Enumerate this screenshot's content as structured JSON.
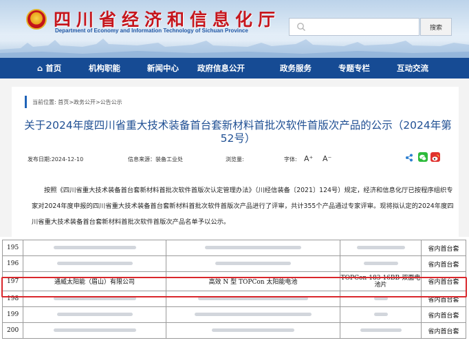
{
  "header": {
    "title": "四川省经济和信息化厅",
    "subtitle": "Department of Economy and Information Technology of Sichuan Province",
    "search_button": "搜索",
    "search_placeholder": ""
  },
  "nav": {
    "items": [
      "首页",
      "机构职能",
      "新闻中心",
      "政府信息公开",
      "政务服务",
      "专题专栏",
      "互动交流"
    ]
  },
  "breadcrumb": "当前位置: 首页>政务公开>公告公示",
  "article": {
    "title": "关于2024年度四川省重大技术装备首台套新材料首批次软件首版次产品的公示（2024年第52号）",
    "date": "发布日期:2024-12-10",
    "source": "信息来源：装备工业处",
    "views": "浏览量:",
    "font_label": "字体:",
    "font_larger": "A⁺",
    "font_smaller": "A⁻",
    "body": "按照《四川省重大技术装备首台套新材料首批次软件首版次认定管理办法》（川经信装备〔2021〕124号）规定，经济和信息化厅已按程序组织专家对2024年度申报的四川省重大技术装备首台套新材料首批次软件首版次产品进行了评审，共计355个产品通过专家评审。现将拟认定的2024年度四川省重大技术装备首台套新材料首批次软件首版次产品名单予以公示。"
  },
  "table": {
    "rows": [
      {
        "no": "195",
        "company": "",
        "product": "",
        "model": "",
        "category": "省内首台套"
      },
      {
        "no": "196",
        "company": "",
        "product": "",
        "model": "",
        "category": "省内首台套"
      },
      {
        "no": "197",
        "company": "通威太阳能（眉山）有限公司",
        "product": "高效 N 型 TOPCon 太阳能电池",
        "model": "TOPCon-183-16BB-双面电池片",
        "category": "省内首台套"
      },
      {
        "no": "198",
        "company": "",
        "product": "",
        "model": "",
        "category": "省内首台套"
      },
      {
        "no": "199",
        "company": "",
        "product": "",
        "model": "",
        "category": "省内首台套"
      },
      {
        "no": "200",
        "company": "",
        "product": "",
        "model": "",
        "category": "省内首台套"
      }
    ]
  },
  "colors": {
    "nav_bg": "#164b94",
    "title_red": "#c5161d",
    "article_title": "#1f4f93",
    "highlight": "#d9262b"
  }
}
